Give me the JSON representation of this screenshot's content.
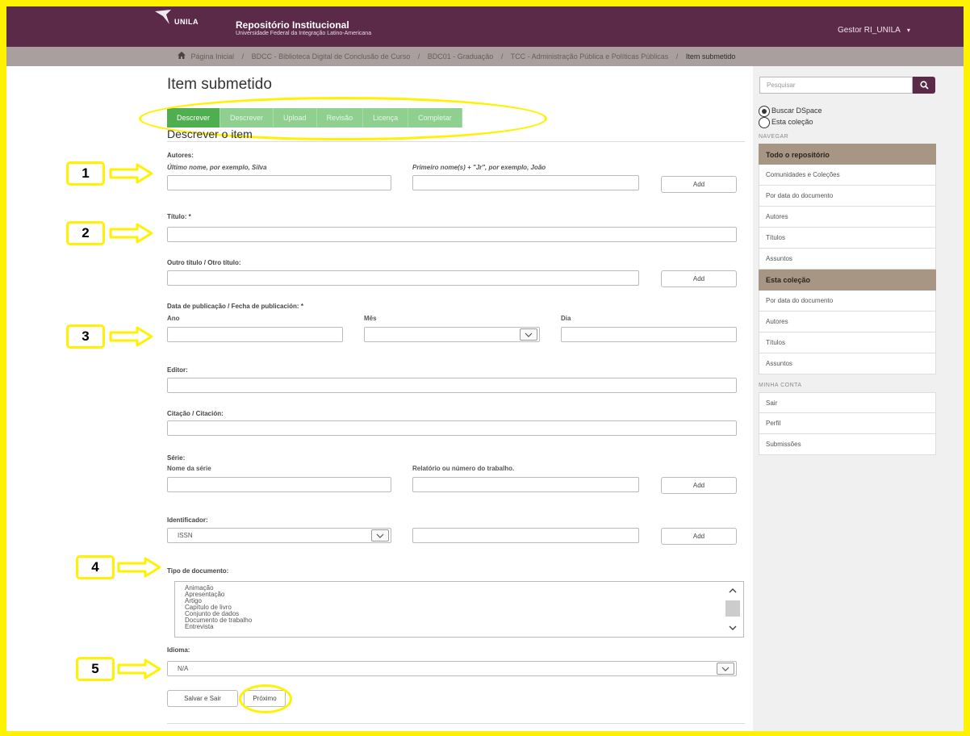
{
  "header": {
    "logo_text": "UNILA",
    "site_title": "Repositório Institucional",
    "site_subtitle": "Universidade Federal da Integração Latino-Americana",
    "user_menu": "Gestor RI_UNILA",
    "user_caret": "▾"
  },
  "breadcrumb": {
    "separator": "/",
    "items": [
      "Página Inicial",
      "BDCC - Biblioteca Digital de Conclusão de Curso",
      "BDC01 - Graduação",
      "TCC - Administração Pública e Políticas Públicas"
    ],
    "current": "Item submetido"
  },
  "main": {
    "page_title": "Item submetido",
    "steps": [
      "Descrever",
      "Descrever",
      "Upload",
      "Revisão",
      "Licença",
      "Completar"
    ],
    "section_title": "Descrever o item",
    "authors": {
      "label": "Autores:",
      "last_name_label": "Último nome, por exemplo, Silva",
      "first_name_label": "Primeiro nome(s) + \"Jr\", por exemplo, João",
      "add": "Add"
    },
    "title": {
      "label": "Título: *"
    },
    "other_title": {
      "label": "Outro título / Otro título:",
      "add": "Add"
    },
    "date": {
      "label": "Data de publicação / Fecha de publicación: *",
      "year": "Ano",
      "month": "Mês",
      "day": "Dia"
    },
    "publisher": {
      "label": "Editor:"
    },
    "citation": {
      "label": "Citação / Citación:"
    },
    "series": {
      "label": "Série:",
      "name_label": "Nome da série",
      "report_label": "Relatório ou número do trabalho.",
      "add": "Add"
    },
    "identifier": {
      "label": "Identificador:",
      "type_value": "ISSN",
      "add": "Add"
    },
    "doc_type": {
      "label": "Tipo de documento:",
      "options": [
        "Animação",
        "Apresentação",
        "Artigo",
        "Capítulo de livro",
        "Conjunto de dados",
        "Documento de trabalho",
        "Entrevista"
      ]
    },
    "language": {
      "label": "Idioma:",
      "value": "N/A"
    },
    "buttons": {
      "save_exit": "Salvar e Sair",
      "next": "Próximo"
    }
  },
  "sidebar": {
    "search_placeholder": "Pesquisar",
    "scope_options": [
      "Buscar DSpace",
      "Esta coleção"
    ],
    "navigate_heading": "NAVEGAR",
    "repo_header": "Todo o repositório",
    "repo_items": [
      "Comunidades e Coleções",
      "Por data do documento",
      "Autores",
      "Títulos",
      "Assuntos"
    ],
    "collection_header": "Esta coleção",
    "collection_items": [
      "Por data do documento",
      "Autores",
      "Títulos",
      "Assuntos"
    ],
    "account_heading": "MINHA CONTA",
    "account_items": [
      "Sair",
      "Perfil",
      "Submissões"
    ]
  },
  "annotations": {
    "markers": [
      "1",
      "2",
      "3",
      "4",
      "5"
    ]
  },
  "colors": {
    "highlight": "#fff200",
    "topbar": "#5b2a48",
    "breadcrumb": "#a89f9e",
    "step_active": "#4fae4f",
    "step_inactive": "#8fcf8f",
    "sidebar_header": "#a79683"
  }
}
